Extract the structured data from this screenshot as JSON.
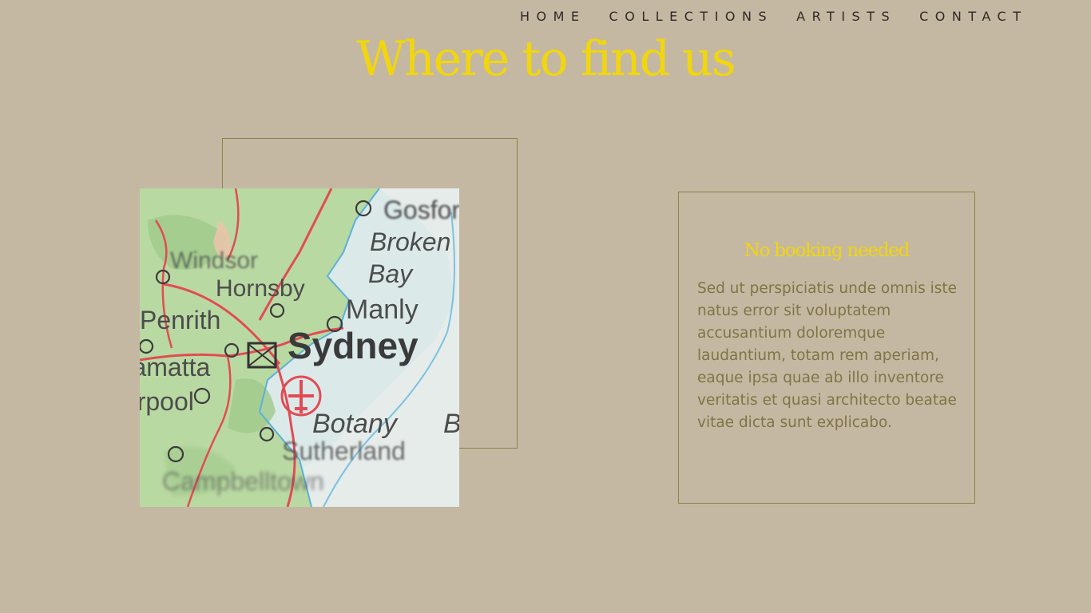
{
  "nav": {
    "items": [
      "HOME",
      "COLLECTIONS",
      "ARTISTS",
      "CONTACT"
    ]
  },
  "hero": {
    "title": "Where to find us"
  },
  "map": {
    "place_labels": [
      "Gosford",
      "Broken",
      "Bay",
      "Windsor",
      "Hornsby",
      "Manly",
      "Penrith",
      "Sydney",
      "Parramatta",
      "Liverpool",
      "Botany",
      "Bay",
      "Sutherland",
      "Campbelltown"
    ]
  },
  "info_card": {
    "title": "No booking needed",
    "body": "Sed ut perspiciatis unde omnis iste natus error sit voluptatem accusantium doloremque laudantium, totam rem aperiam, eaque ipsa quae ab illo inventore veritatis et quasi architecto beatae vitae dicta sunt explicabo."
  },
  "colors": {
    "background": "#c4b8a3",
    "accent": "#f2d60c",
    "body_text": "#807444",
    "border": "#8f8148",
    "nav_text": "#2e2a25"
  }
}
